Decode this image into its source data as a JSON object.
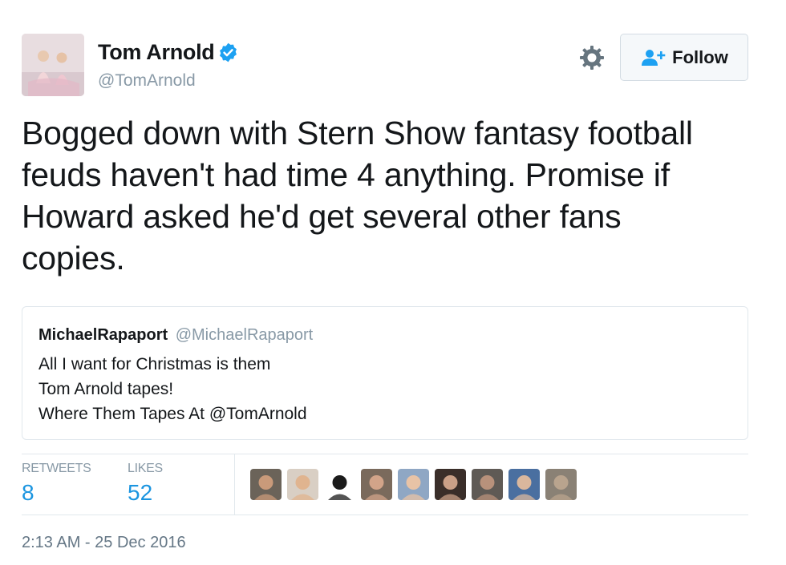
{
  "user": {
    "display_name": "Tom Arnold",
    "handle": "@TomArnold",
    "verified": true,
    "avatar_alt": "profile photo"
  },
  "follow_button": {
    "label": "Follow",
    "icon": "add-user-icon"
  },
  "settings": {
    "icon": "gear-icon"
  },
  "tweet": {
    "lines": [
      "Bogged down with Stern Show fantasy football",
      "feuds haven't had time 4 anything. Promise if",
      "Howard asked he'd get several other fans",
      "copies."
    ]
  },
  "quoted_tweet": {
    "name": "MichaelRapaport",
    "handle": "@MichaelRapaport",
    "lines": [
      "All I want for Christmas is them",
      "Tom Arnold tapes!",
      "Where Them Tapes At @TomArnold"
    ]
  },
  "stats": {
    "retweets_label": "RETWEETS",
    "retweets": "8",
    "likes_label": "LIKES",
    "likes": "52"
  },
  "likers": [
    {
      "bg": "#6b6359",
      "fg": "#c99a7a"
    },
    {
      "bg": "#d9cfc4",
      "fg": "#e0b48f"
    },
    {
      "bg": "#ffffff",
      "fg": "#1b1b1b"
    },
    {
      "bg": "#7a6a5c",
      "fg": "#d2a489"
    },
    {
      "bg": "#8fa7c4",
      "fg": "#e8c3a6"
    },
    {
      "bg": "#3a2e29",
      "fg": "#caa087"
    },
    {
      "bg": "#5f5a55",
      "fg": "#b8917b"
    },
    {
      "bg": "#4a6fa0",
      "fg": "#d9b79d"
    },
    {
      "bg": "#8a8175",
      "fg": "#b9a48e"
    }
  ],
  "timestamp": "2:13 AM - 25 Dec 2016",
  "colors": {
    "accent": "#1b95e0",
    "verified": "#1da1f2",
    "muted": "#8899a6"
  }
}
